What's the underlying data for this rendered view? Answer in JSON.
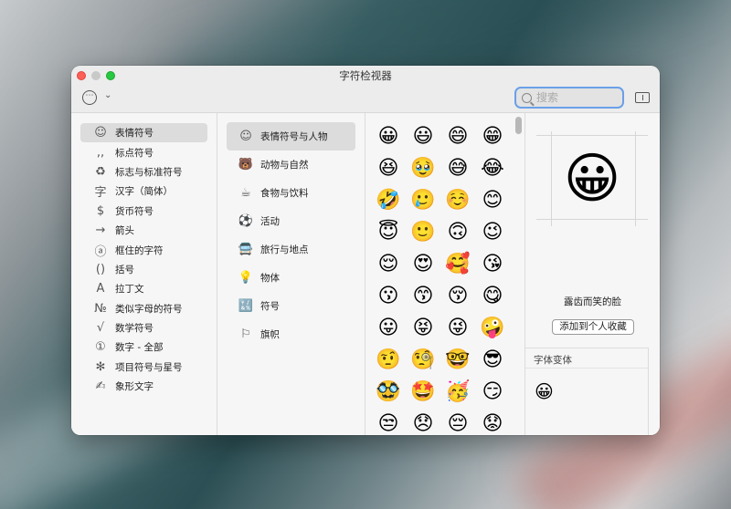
{
  "window": {
    "title": "字符检视器"
  },
  "toolbar": {
    "more_glyph": "⋯",
    "chevron_glyph": "⌄",
    "search_placeholder": "搜索"
  },
  "categories": [
    {
      "icon": "☺",
      "label": "表情符号",
      "selected": true
    },
    {
      "icon": ",,",
      "label": "标点符号"
    },
    {
      "icon": "♻",
      "label": "标志与标准符号"
    },
    {
      "icon": "字",
      "label": "汉字（简体）"
    },
    {
      "icon": "$",
      "label": "货币符号"
    },
    {
      "icon": "→",
      "label": "箭头"
    },
    {
      "icon": "ⓐ",
      "label": "框住的字符"
    },
    {
      "icon": "()",
      "label": "括号"
    },
    {
      "icon": "A",
      "label": "拉丁文"
    },
    {
      "icon": "№",
      "label": "类似字母的符号"
    },
    {
      "icon": "√",
      "label": "数学符号"
    },
    {
      "icon": "①",
      "label": "数字 - 全部"
    },
    {
      "icon": "✻",
      "label": "项目符号与星号"
    },
    {
      "icon": "✍",
      "label": "象形文字"
    }
  ],
  "subcategories": [
    {
      "icon": "☺",
      "label": "表情符号与人物",
      "selected": true
    },
    {
      "icon": "🐻",
      "label": "动物与自然"
    },
    {
      "icon": "☕",
      "label": "食物与饮料"
    },
    {
      "icon": "⚽",
      "label": "活动"
    },
    {
      "icon": "🚍",
      "label": "旅行与地点"
    },
    {
      "icon": "💡",
      "label": "物体"
    },
    {
      "icon": "🔣",
      "label": "符号"
    },
    {
      "icon": "⚐",
      "label": "旗帜"
    }
  ],
  "emojis": [
    "😀",
    "😃",
    "😄",
    "😁",
    "😆",
    "🥹",
    "😅",
    "😂",
    "🤣",
    "🥲",
    "☺️",
    "😊",
    "😇",
    "🙂",
    "🙃",
    "😉",
    "😌",
    "😍",
    "🥰",
    "😘",
    "😗",
    "😙",
    "😚",
    "😋",
    "😛",
    "😝",
    "😜",
    "🤪",
    "🤨",
    "🧐",
    "🤓",
    "😎",
    "🥸",
    "🤩",
    "🥳",
    "😏",
    "😒",
    "😞",
    "😔",
    "😟"
  ],
  "detail": {
    "preview": "😀",
    "name": "露齿而笑的脸",
    "add_favorite": "添加到个人收藏",
    "variants_label": "字体变体",
    "variants": [
      "😀"
    ]
  }
}
